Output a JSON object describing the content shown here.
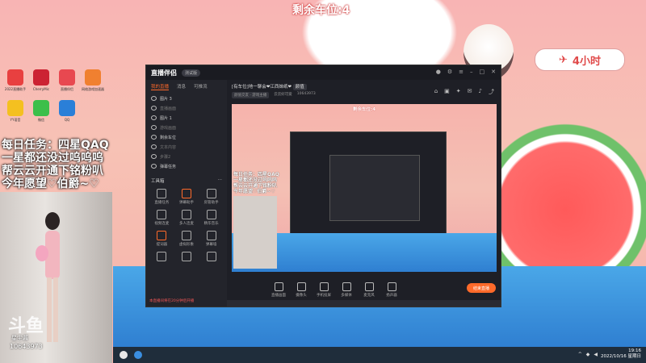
{
  "banner": {
    "title": "剩余车位:4"
  },
  "desktop": {
    "icons": [
      {
        "label": "2022直播助手",
        "color": "#e84040"
      },
      {
        "label": "CherryMic",
        "color": "#cc2233"
      },
      {
        "label": "直播伴侣",
        "color": "#e84850"
      },
      {
        "label": "网络游戏加速器",
        "color": "#f08030"
      },
      {
        "label": "YY语音",
        "color": "#f4c020"
      },
      {
        "label": "微信",
        "color": "#3cbf4a"
      },
      {
        "label": "QQ",
        "color": "#2a7fd8"
      }
    ]
  },
  "task_text": [
    "每日任务：四星QAQ",
    "一星都还没过呜呜呜",
    "帮云云开通下铭粉叭",
    "今年愿望♡伯爵~♡"
  ],
  "sticker_pill": "4小时",
  "camera": {
    "brand": "斗鱼",
    "name": "星尘酱",
    "id": "10643973"
  },
  "app": {
    "name": "直播伴侣",
    "version": "测试版",
    "left_tabs": [
      "我的直播",
      "消息",
      "可推流"
    ],
    "layers": [
      {
        "label": "图片 3",
        "dim": false
      },
      {
        "label": "直播画面",
        "dim": true
      },
      {
        "label": "图片 1",
        "dim": false
      },
      {
        "label": "游戏画面",
        "dim": true
      },
      {
        "label": "剩余车位",
        "dim": false
      },
      {
        "label": "文本内容",
        "dim": true
      },
      {
        "label": "步骤2",
        "dim": true
      },
      {
        "label": "弹幕任务",
        "dim": false
      }
    ],
    "tools_header": "工具箱",
    "tools": [
      {
        "label": "直播任务",
        "hot": false
      },
      {
        "label": "弹幕助手",
        "hot": true
      },
      {
        "label": "房管助手",
        "hot": false
      },
      {
        "label": "视频连麦",
        "hot": false
      },
      {
        "label": "多人连麦",
        "hot": false
      },
      {
        "label": "精华音乐",
        "hot": false
      },
      {
        "label": "提词器",
        "hot": true
      },
      {
        "label": "虚拟形象",
        "hot": false
      },
      {
        "label": "弹幕墙",
        "hot": false
      },
      {
        "label": "",
        "hot": false
      },
      {
        "label": "",
        "hot": false
      },
      {
        "label": "",
        "hot": false
      }
    ],
    "footer_notice": "本直播间将在20分钟后开播",
    "stream_title": "[有车位]地一聊会❤江西妹纸❤",
    "stream_tag": "颜值",
    "meta": [
      "颜值交友 · 游戏主播",
      "云云好可爱",
      "10643973"
    ],
    "preview_banner": "剩余车位:4",
    "preview_text": [
      "每日任务：四星QAQ",
      "一星都还没过呜呜呜",
      "帮云云开通下铭粉叭",
      "今年愿望♡伯爵~♡"
    ],
    "controls": [
      "直播画面",
      "摄像头",
      "手机投屏",
      "多媒体",
      "麦克风",
      "扬声器"
    ],
    "start_button": "结束直播"
  },
  "taskbar": {
    "time": "19:16",
    "date": "2022/10/16 星期日"
  }
}
